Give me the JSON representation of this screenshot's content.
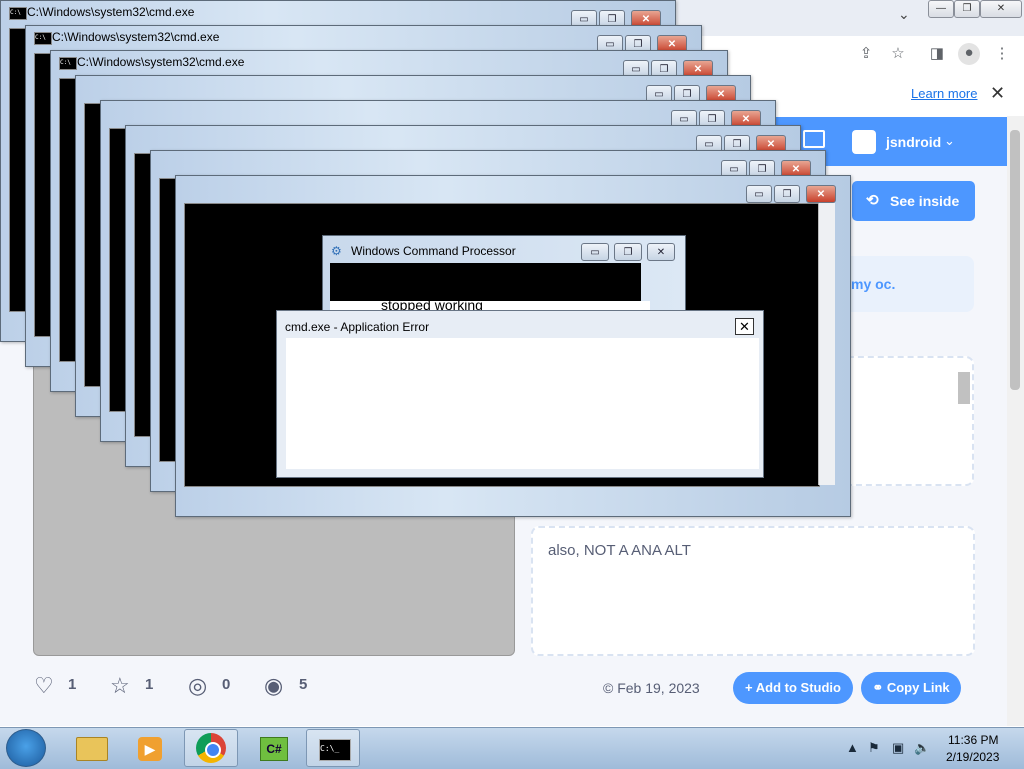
{
  "browser": {
    "caption_buttons": [
      "—",
      "❐",
      "✕"
    ],
    "tab_dropdown": "⌄",
    "toolbar_icons": [
      "share-icon",
      "star-icon",
      "sidepanel-icon",
      "profile-icon",
      "menu-icon"
    ]
  },
  "notice": {
    "learn_more": "Learn more",
    "close": "✕"
  },
  "scratch": {
    "username": "jsndroid",
    "see_inside": "See inside",
    "description_fragment": "my oc.",
    "credits": "also, NOT A ANA ALT",
    "stats": {
      "loves": "1",
      "favorites": "1",
      "remixes": "0",
      "views": "5"
    },
    "date": "© Feb 19, 2023",
    "add_to_studio": "Add to Studio",
    "copy_link": "Copy Link"
  },
  "cmd_windows": {
    "title": "C:\\Windows\\system32\\cmd.exe",
    "caption": [
      "▭",
      "❐",
      "✕"
    ]
  },
  "wcp": {
    "title": "Windows Command Processor",
    "text": "stopped working"
  },
  "error_dialog": {
    "title": "cmd.exe - Application Error",
    "close": "✕"
  },
  "taskbar": {
    "apps": [
      "explorer-icon",
      "media-player-icon",
      "chrome-icon",
      "csharp-icon",
      "cmd-icon"
    ],
    "time": "11:36 PM",
    "date": "2/19/2023"
  }
}
